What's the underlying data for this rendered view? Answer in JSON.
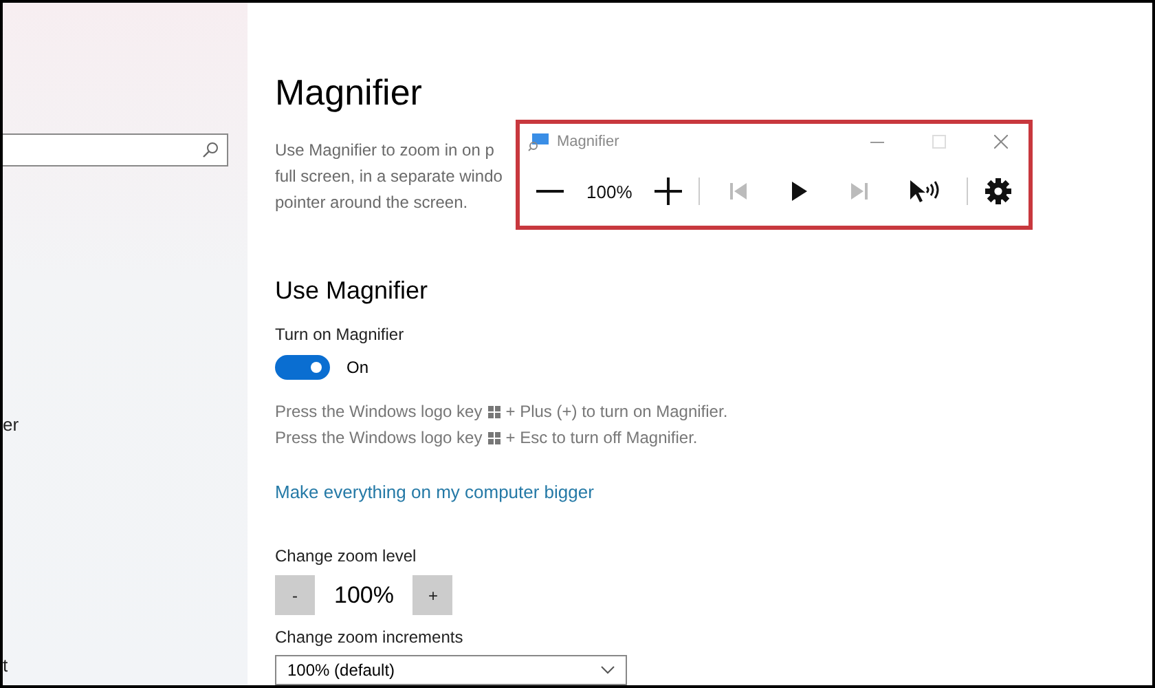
{
  "sidebar": {
    "items": [
      {
        "label": "er"
      },
      {
        "label": "t"
      }
    ]
  },
  "page": {
    "title": "Magnifier",
    "description": [
      "Use Magnifier to zoom in on p",
      "full screen, in a separate windo",
      "pointer around the screen."
    ],
    "section_title": "Use Magnifier",
    "toggle": {
      "label": "Turn on Magnifier",
      "on": true,
      "state_text": "On"
    },
    "shortcuts": [
      {
        "before": "Press the Windows logo key",
        "after": "+ Plus (+) to turn on Magnifier."
      },
      {
        "before": "Press the Windows logo key",
        "after": "+ Esc to turn off Magnifier."
      }
    ],
    "link": "Make everything on my computer bigger",
    "zoom_level": {
      "label": "Change zoom level",
      "decrease": "-",
      "value": "100%",
      "increase": "+"
    },
    "zoom_increments": {
      "label": "Change zoom increments",
      "value": "100% (default)"
    }
  },
  "magnifier_window": {
    "title": "Magnifier",
    "highlighted": true,
    "zoom": "100%",
    "tools": [
      {
        "kind": "prev",
        "disabled": true
      },
      {
        "kind": "play",
        "disabled": false
      },
      {
        "kind": "next",
        "disabled": true
      },
      {
        "kind": "pointer-read",
        "disabled": false
      }
    ]
  }
}
